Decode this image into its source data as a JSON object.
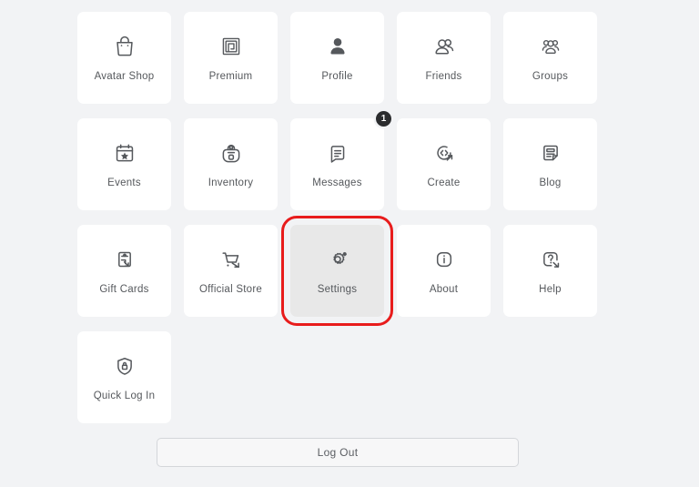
{
  "page": {
    "background_color": "#f2f3f5",
    "tile_color": "#ffffff",
    "selected_tile_color": "#e8e8e8",
    "highlight_color": "#e81c1c",
    "text_color": "#55585c"
  },
  "menu": {
    "items": [
      {
        "label": "Avatar Shop",
        "icon": "shopping-bag-icon",
        "selected": false,
        "badge": null
      },
      {
        "label": "Premium",
        "icon": "premium-spiral-icon",
        "selected": false,
        "badge": null
      },
      {
        "label": "Profile",
        "icon": "person-icon",
        "selected": false,
        "badge": null
      },
      {
        "label": "Friends",
        "icon": "two-people-icon",
        "selected": false,
        "badge": null
      },
      {
        "label": "Groups",
        "icon": "three-people-icon",
        "selected": false,
        "badge": null
      },
      {
        "label": "Events",
        "icon": "calendar-star-icon",
        "selected": false,
        "badge": null
      },
      {
        "label": "Inventory",
        "icon": "backpack-icon",
        "selected": false,
        "badge": null
      },
      {
        "label": "Messages",
        "icon": "message-document-icon",
        "selected": false,
        "badge": "1"
      },
      {
        "label": "Create",
        "icon": "code-external-link-icon",
        "selected": false,
        "badge": null
      },
      {
        "label": "Blog",
        "icon": "blog-page-icon",
        "selected": false,
        "badge": null
      },
      {
        "label": "Gift Cards",
        "icon": "gift-card-external-link-icon",
        "selected": false,
        "badge": null
      },
      {
        "label": "Official Store",
        "icon": "shopping-cart-external-link-icon",
        "selected": false,
        "badge": null
      },
      {
        "label": "Settings",
        "icon": "gear-sparkle-icon",
        "selected": true,
        "badge": null
      },
      {
        "label": "About",
        "icon": "info-circle-icon",
        "selected": false,
        "badge": null
      },
      {
        "label": "Help",
        "icon": "question-external-link-icon",
        "selected": false,
        "badge": null
      },
      {
        "label": "Quick Log In",
        "icon": "shield-lock-icon",
        "selected": false,
        "badge": null
      }
    ]
  },
  "footer": {
    "logout_label": "Log Out"
  }
}
